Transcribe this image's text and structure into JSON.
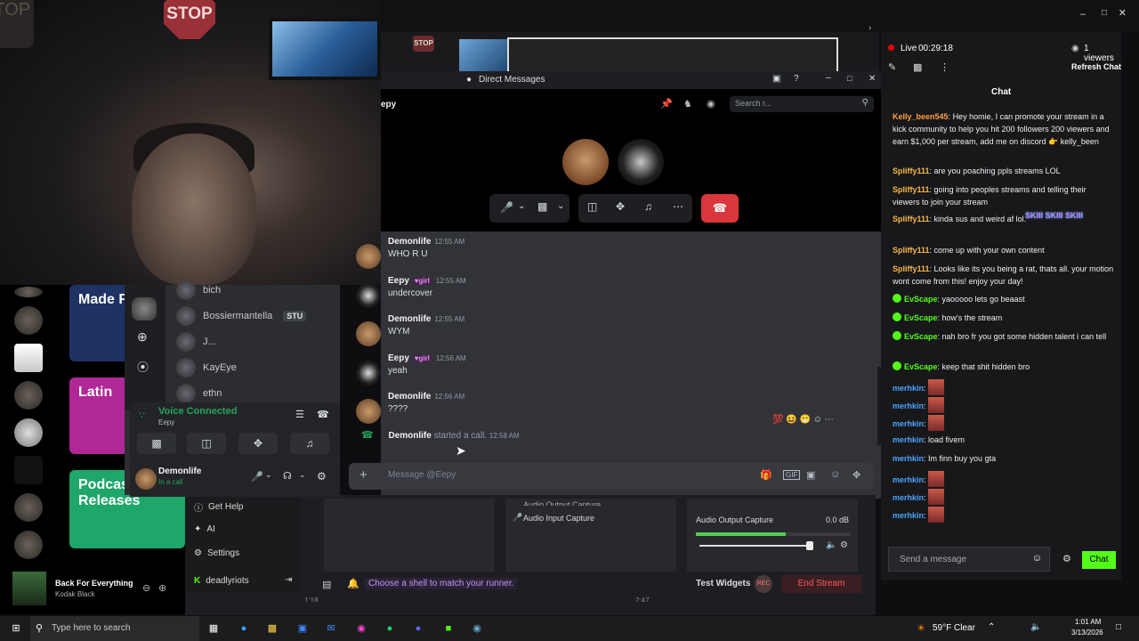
{
  "webcam": {
    "stop_sign": "STOP",
    "stop_sign_bg": "STOP"
  },
  "spotify": {
    "cards": [
      {
        "label": "Made F",
        "color": "#1e3264"
      },
      {
        "label": "Latin",
        "color": "#af2896"
      },
      {
        "label": "Podcast Releases",
        "color": "#1ea66b"
      }
    ],
    "now_playing": {
      "title": "Back For Everything",
      "artist": "Kodak Black"
    }
  },
  "discord_server": {
    "members": [
      {
        "name": "bich",
        "tag": ""
      },
      {
        "name": "Bossiermantella",
        "tag": "STU"
      },
      {
        "name": "J...",
        "tag": ""
      },
      {
        "name": "KayEye",
        "tag": ""
      },
      {
        "name": "ethn",
        "tag": ""
      }
    ],
    "voice": {
      "status": "Voice Connected",
      "channel": "Eepy"
    },
    "user": {
      "name": "Demonlife",
      "status": "In a call"
    }
  },
  "obs_nav": {
    "items": [
      "Get Help",
      "AI",
      "Settings"
    ],
    "account": "deadlyriots"
  },
  "obs_mixer": {
    "audio_input": "Audio Input Capture",
    "audio_output": "Audio Output Capture",
    "audio_output_cut": "Audio Output Capture",
    "level": "0.0 dB",
    "level_fraction": 0.58
  },
  "stream_bar": {
    "tip": "Choose a shell to match your runner.",
    "test_widgets": "Test Widgets",
    "rec": "REC",
    "end_stream": "End Stream",
    "time_left": "1:18",
    "time_right": "2:47"
  },
  "dm_window": {
    "title": "Direct Messages",
    "recipient": "epy",
    "search_placeholder": "Search r...",
    "composer_placeholder": "Message @Eepy",
    "messages": [
      {
        "author": "Demonlife",
        "badge": "",
        "time": "12:55 AM",
        "text": "WHO R U"
      },
      {
        "author": "Eepy",
        "badge": "girl",
        "time": "12:55 AM",
        "text": "undercover"
      },
      {
        "author": "Demonlife",
        "badge": "",
        "time": "12:55 AM",
        "text": "WYM"
      },
      {
        "author": "Eepy",
        "badge": "girl",
        "time": "12:56 AM",
        "text": "yeah"
      },
      {
        "author": "Demonlife",
        "badge": "",
        "time": "12:56 AM",
        "text": "????"
      }
    ],
    "call_event": {
      "author": "Demonlife",
      "text": "started a call.",
      "time": "12:58 AM"
    }
  },
  "stream_header": {
    "live_label": "Live",
    "live_time": "00:29:18",
    "viewers": "1 viewers",
    "refresh": "Refresh Chat",
    "chat_title": "Chat",
    "input_placeholder": "Send a message",
    "chat_button": "Chat"
  },
  "chat_messages": [
    {
      "user": "Kelly_been545",
      "color": "#ff9f43",
      "text": "Hey homie, I can promote your stream in a kick community to help you hit 200 followers 200 viewers and earn $1,000 per stream, add me on discord 👉 kelly_been"
    },
    {
      "user": "Spliffy111",
      "color": "#f5b74a",
      "text": "are you poaching ppls streams LOL"
    },
    {
      "user": "Spliffy111",
      "color": "#f5b74a",
      "text": "going into peoples streams and telling their viewers to join your stream"
    },
    {
      "user": "Spliffy111",
      "color": "#f5b74a",
      "text": "kinda sus and weird af lol."
    },
    {
      "user": "Spliffy111",
      "color": "#f5b74a",
      "text": "come up with your own content"
    },
    {
      "user": "Spliffy111",
      "color": "#f5b74a",
      "text": "Looks like its you being a rat, thats all. your motion wont come from this! enjoy your day!"
    },
    {
      "user": "EvScape",
      "color": "#53fc18",
      "text": "yaooooo lets go beaast"
    },
    {
      "user": "EvScape",
      "color": "#53fc18",
      "text": "how's the stream"
    },
    {
      "user": "EvScape",
      "color": "#53fc18",
      "text": "nah bro fr you got some hidden talent i can tell"
    },
    {
      "user": "EvScape",
      "color": "#53fc18",
      "text": "keep that shit hidden bro"
    },
    {
      "user": "merhkin",
      "color": "#4aa3ff",
      "text": ""
    },
    {
      "user": "merhkin",
      "color": "#4aa3ff",
      "text": ""
    },
    {
      "user": "merhkin",
      "color": "#4aa3ff",
      "text": ""
    },
    {
      "user": "merhkin",
      "color": "#4aa3ff",
      "text": "load fivem"
    },
    {
      "user": "merhkin",
      "color": "#4aa3ff",
      "text": "Im finn buy you gta"
    },
    {
      "user": "merhkin",
      "color": "#4aa3ff",
      "text": ""
    },
    {
      "user": "merhkin",
      "color": "#4aa3ff",
      "text": ""
    },
    {
      "user": "merhkin",
      "color": "#4aa3ff",
      "text": ""
    }
  ],
  "chat_emote_text": "SKIII SKIII SKIII",
  "taskbar": {
    "search_placeholder": "Type here to search",
    "weather": "59°F Clear",
    "time": "1:01 AM",
    "date": "3/13/2026"
  }
}
